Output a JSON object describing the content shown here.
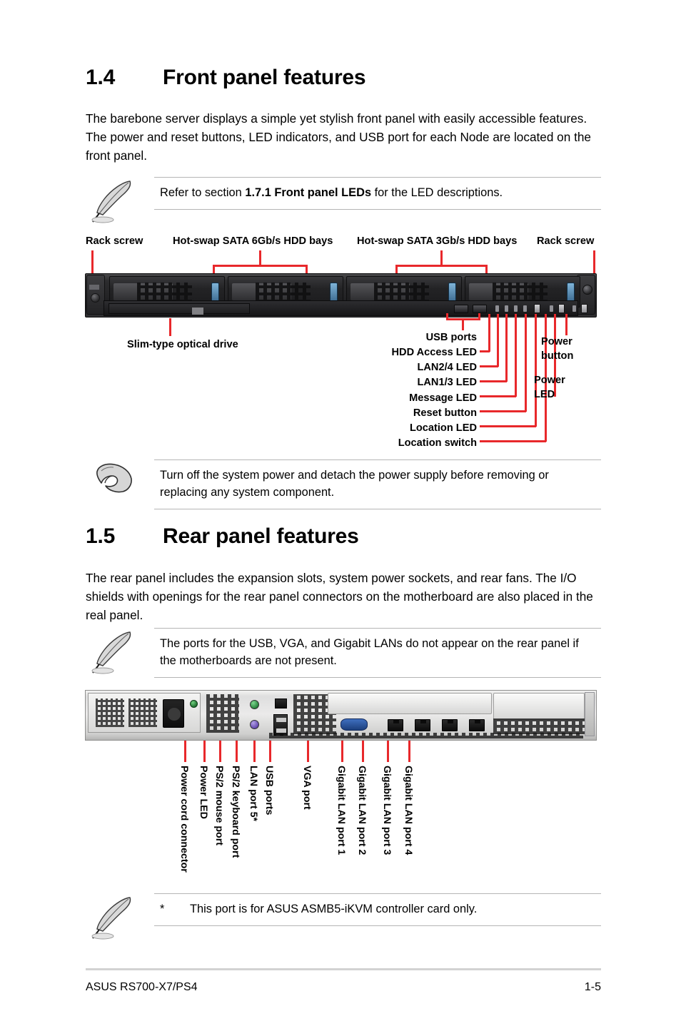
{
  "document": {
    "footer_left": "ASUS RS700-X7/PS4",
    "page_number": "1-5"
  },
  "sections": [
    {
      "number": "1.4",
      "title": "Front panel features",
      "body": "The barebone server displays a simple yet stylish front panel with easily accessible features. The power and reset buttons, LED indicators, and USB port for each Node are located on the front panel."
    },
    {
      "number": "1.5",
      "title": "Rear panel features",
      "body": "The rear panel includes the expansion slots, system power sockets, and rear fans. The I/O shields with openings for the rear panel connectors on the motherboard are also placed in the real panel."
    }
  ],
  "notes": {
    "front_panel_leds": {
      "icon": "feather-note-icon",
      "text_before": "Refer to section ",
      "text_bold": "1.7.1 Front panel LEDs",
      "text_after": " for the LED descriptions."
    },
    "power_warning": {
      "icon": "hand-caution-icon",
      "text": "Turn off the system power and detach the power supply before removing or replacing any system component."
    },
    "rear_ports": {
      "icon": "feather-note-icon",
      "text": "The ports for the USB, VGA, and Gigabit LANs do not appear on the rear panel if the motherboards are not present."
    },
    "footnote": {
      "icon": "feather-note-icon",
      "marker": "*",
      "text": "This port is for ASUS ASMB5-iKVM controller card only."
    }
  },
  "front_panel": {
    "image_alt": "front-panel-photo",
    "top_callouts": [
      {
        "label": "Rack screw"
      },
      {
        "label": "Hot-swap SATA 6Gb/s HDD bays"
      },
      {
        "label": "Hot-swap SATA 3Gb/s HDD bays"
      },
      {
        "label": "Rack screw"
      }
    ],
    "bottom_left_callout": {
      "label": "Slim-type optical drive"
    },
    "stack_callouts": [
      {
        "label": "USB ports"
      },
      {
        "label": "HDD Access LED"
      },
      {
        "label": "LAN2/4 LED"
      },
      {
        "label": "LAN1/3 LED"
      },
      {
        "label": "Message LED"
      },
      {
        "label": "Reset button"
      },
      {
        "label": "Location LED"
      },
      {
        "label": "Location switch"
      }
    ],
    "right_callouts": [
      {
        "label": "Power"
      },
      {
        "label": "button"
      },
      {
        "label": "Power"
      },
      {
        "label": "LED"
      }
    ],
    "right_callout_groups": [
      {
        "label": "Power button"
      },
      {
        "label": "Power LED"
      }
    ]
  },
  "rear_panel": {
    "image_alt": "rear-panel-photo",
    "callouts": [
      {
        "label": "Power cord connector"
      },
      {
        "label": "Power LED"
      },
      {
        "label": "PS/2 mouse port"
      },
      {
        "label": "PS/2 keyboard port"
      },
      {
        "label": "LAN port 5*"
      },
      {
        "label": "USB ports"
      },
      {
        "label": "VGA port"
      },
      {
        "label": "Gigabit LAN port 1"
      },
      {
        "label": "Gigabit LAN port 2"
      },
      {
        "label": "Gigabit LAN port 3"
      },
      {
        "label": "Gigabit LAN port 4"
      }
    ]
  },
  "colors": {
    "leader_red": "#e8282b",
    "rule_gray": "#b5b5b5",
    "footer_rule": "#d2d2d2",
    "text": "#000000"
  }
}
